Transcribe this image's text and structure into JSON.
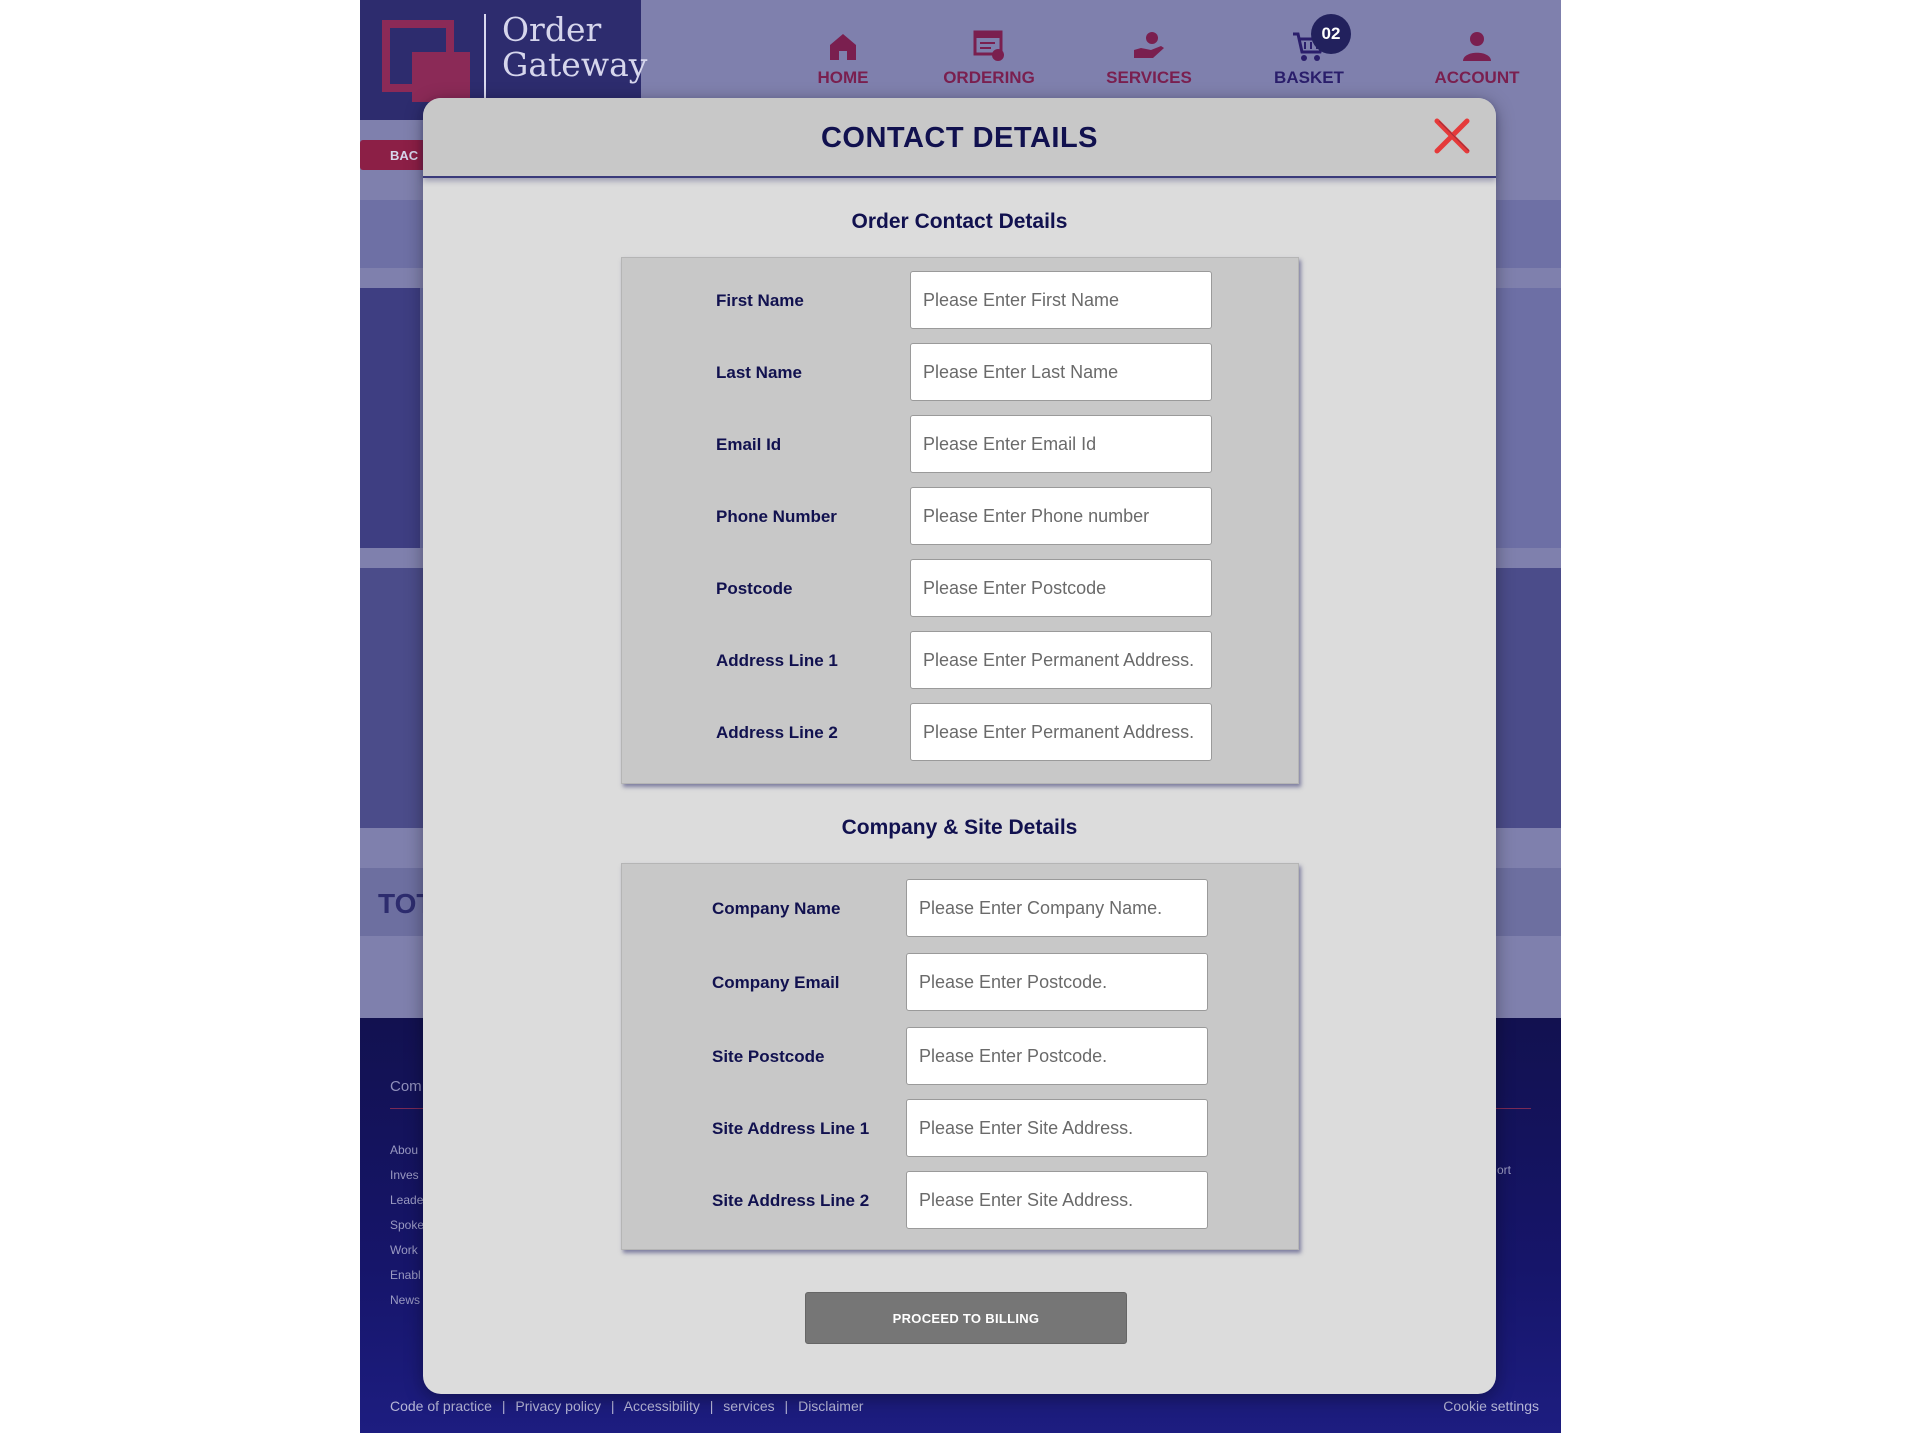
{
  "brand": {
    "name_line1": "Order",
    "name_line2": "Gateway"
  },
  "nav": {
    "items": [
      {
        "label": "HOME",
        "icon": "home-icon"
      },
      {
        "label": "ORDERING",
        "icon": "ordering-icon"
      },
      {
        "label": "SERVICES",
        "icon": "services-icon"
      },
      {
        "label": "BASKET",
        "icon": "basket-icon"
      },
      {
        "label": "ACCOUNT",
        "icon": "account-icon"
      }
    ],
    "basket_count": "02"
  },
  "background": {
    "back_label": "BAC",
    "total_label": "TOT",
    "footer_col_title": "Com",
    "footer_links": [
      "Abou",
      "Inves",
      "Leade",
      "Spoke",
      "Work",
      "Enabl",
      "News"
    ],
    "footer_right_link": "ort"
  },
  "footer": {
    "bottom_links": [
      "Code of practice",
      "Privacy policy",
      "Accessibility",
      "services",
      "Disclaimer"
    ],
    "cookie_settings": "Cookie settings"
  },
  "modal": {
    "title": "CONTACT DETAILS",
    "close_icon": "close-icon",
    "section1": {
      "heading": "Order Contact Details",
      "fields": [
        {
          "label": "First Name",
          "placeholder": "Please Enter First Name",
          "value": ""
        },
        {
          "label": "Last Name",
          "placeholder": "Please Enter Last Name",
          "value": ""
        },
        {
          "label": "Email Id",
          "placeholder": "Please Enter Email Id",
          "value": ""
        },
        {
          "label": "Phone Number",
          "placeholder": "Please Enter Phone number",
          "value": ""
        },
        {
          "label": "Postcode",
          "placeholder": "Please Enter Postcode",
          "value": ""
        },
        {
          "label": "Address Line 1",
          "placeholder": "Please Enter Permanent Address.",
          "value": ""
        },
        {
          "label": "Address Line 2",
          "placeholder": "Please Enter Permanent Address.",
          "value": ""
        }
      ]
    },
    "section2": {
      "heading": "Company & Site Details",
      "fields": [
        {
          "label": "Company Name",
          "placeholder": "Please Enter Company Name.",
          "value": ""
        },
        {
          "label": "Company Email",
          "placeholder": "Please Enter Postcode.",
          "value": ""
        },
        {
          "label": "Site Postcode",
          "placeholder": "Please Enter Postcode.",
          "value": ""
        },
        {
          "label": "Site Address Line 1",
          "placeholder": "Please Enter Site Address.",
          "value": ""
        },
        {
          "label": "Site Address Line 2",
          "placeholder": "Please Enter Site Address.",
          "value": ""
        }
      ]
    },
    "proceed_label": "PROCEED TO BILLING"
  },
  "colors": {
    "brand_navy": "#11114f",
    "accent_maroon": "#8b2a57",
    "modal_bg": "#dcdcdc",
    "panel_bg": "#c8c8c8",
    "button_grey": "#767676",
    "close_red": "#e53a3a"
  }
}
